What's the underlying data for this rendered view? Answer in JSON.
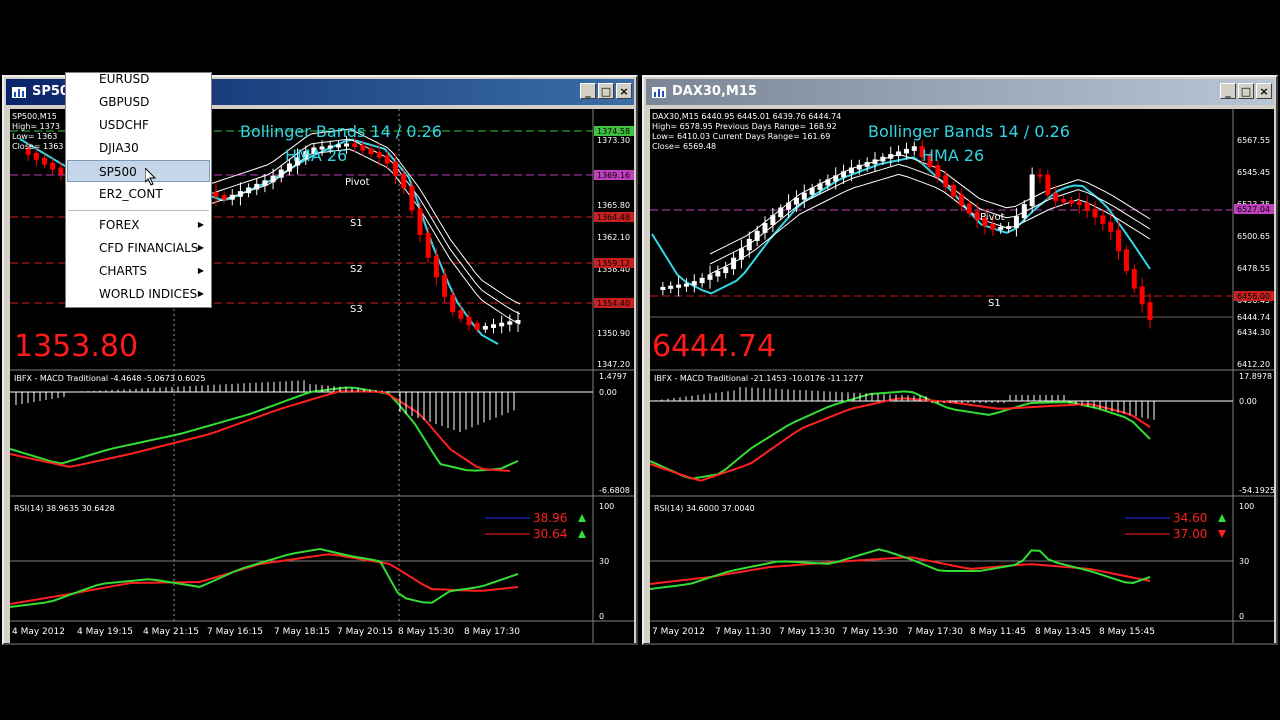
{
  "left_window": {
    "title": "SP500",
    "buttons": [
      "_",
      "□",
      "×"
    ],
    "info": [
      "SP500,M15",
      "High= 1373",
      "Low= 1363",
      "Close= 1363"
    ],
    "indicator": [
      "Bollinger Bands 14 / 0.26",
      "HMA 26"
    ],
    "pivot_labels": [
      "Pivot",
      "S1",
      "S2",
      "S3"
    ],
    "big_price": "1353.80",
    "price_axis": [
      "1373.30",
      "1365.80",
      "1362.10",
      "1358.40",
      "1350.90",
      "1347.20"
    ],
    "price_tags": [
      "1374.58",
      "1369.16",
      "1364.48",
      "1359.12",
      "1354.40"
    ],
    "macd_label": "IBFX - MACD Traditional -4.4648 -5.0673 0.6025",
    "macd_axis": [
      "1.4797",
      "0.00",
      "-6.6808"
    ],
    "rsi_label": "RSI(14) 38.9635 30.6428",
    "rsi_values": [
      "38.96",
      "30.64"
    ],
    "rsi_axis": [
      "100",
      "30",
      "0"
    ],
    "time_axis": [
      "4 May 2012",
      "4 May 19:15",
      "4 May 21:15",
      "7 May 16:15",
      "7 May 18:15",
      "7 May 20:15",
      "8 May 15:30",
      "8 May 17:30"
    ]
  },
  "right_window": {
    "title": "DAX30,M15",
    "buttons": [
      "_",
      "□",
      "×"
    ],
    "info": [
      "DAX30,M15  6440.95 6445.01 6439.76 6444.74",
      "High= 6578.95    Previous Days Range= 168.92",
      "Low= 6410.03    Current Days Range= 161.69",
      "Close= 6569.48"
    ],
    "indicator": [
      "Bollinger Bands 14 / 0.26",
      "HMA 26"
    ],
    "pivot_labels": [
      "Pivot",
      "S1"
    ],
    "big_price": "6444.74",
    "price_axis": [
      "6567.55",
      "6545.45",
      "6523.35",
      "6500.65",
      "6478.55",
      "6456.45",
      "6444.74",
      "6434.30",
      "6412.20"
    ],
    "price_tags": [
      "6527.04",
      "6456.00"
    ],
    "macd_label": "IBFX - MACD Traditional -21.1453 -10.0176 -11.1277",
    "macd_axis": [
      "17.8978",
      "0.00",
      "-54.1925"
    ],
    "rsi_label": "RSI(14) 34.6000 37.0040",
    "rsi_values": [
      "34.60",
      "37.00"
    ],
    "rsi_axis": [
      "100",
      "30",
      "0"
    ],
    "time_axis": [
      "7 May 2012",
      "7 May 11:30",
      "7 May 13:30",
      "7 May 15:30",
      "7 May 17:30",
      "8 May 11:45",
      "8 May 13:45",
      "8 May 15:45"
    ]
  },
  "menu": {
    "items": [
      "EURUSD",
      "GBPUSD",
      "USDCHF",
      "DJIA30",
      "SP500",
      "ER2_CONT"
    ],
    "submenus": [
      "FOREX",
      "CFD FINANCIALS",
      "CHARTS",
      "WORLD INDICES"
    ],
    "selected": "SP500"
  },
  "colors": {
    "bull": "#ffffff",
    "bear": "#ff0000",
    "bands": "#ffffff",
    "hma": "#33d6e6",
    "macd": "#33dd33",
    "signal": "#ff2020",
    "indicator_text": "#33d6e6",
    "big_price": "#ff1a1a",
    "pivot": "#c040c0",
    "support": "#c82020",
    "resistance": "#40c040"
  }
}
